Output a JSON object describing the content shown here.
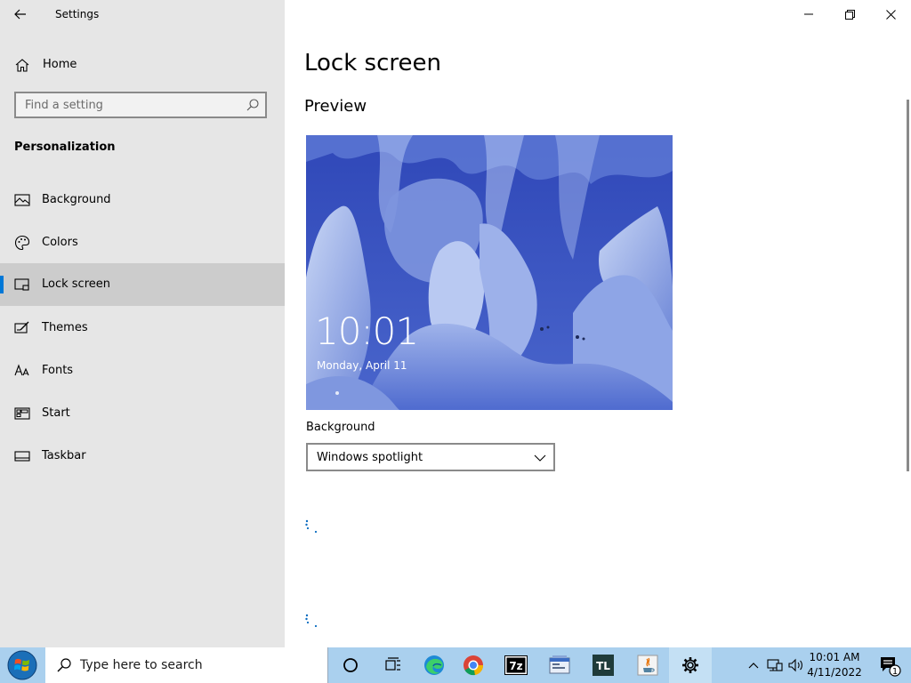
{
  "window": {
    "title": "Settings"
  },
  "sidebar": {
    "home_label": "Home",
    "search_placeholder": "Find a setting",
    "section_heading": "Personalization",
    "items": [
      {
        "label": "Background",
        "icon": "image-icon"
      },
      {
        "label": "Colors",
        "icon": "palette-icon"
      },
      {
        "label": "Lock screen",
        "icon": "lock-screen-icon",
        "selected": true
      },
      {
        "label": "Themes",
        "icon": "themes-icon"
      },
      {
        "label": "Fonts",
        "icon": "fonts-icon"
      },
      {
        "label": "Start",
        "icon": "start-icon"
      },
      {
        "label": "Taskbar",
        "icon": "taskbar-icon"
      }
    ]
  },
  "main": {
    "page_title": "Lock screen",
    "preview_heading": "Preview",
    "preview": {
      "time": "10:01",
      "date": "Monday, April 11"
    },
    "background_label": "Background",
    "background_value": "Windows spotlight"
  },
  "taskbar": {
    "search_placeholder": "Type here to search",
    "apps": [
      "cortana-icon",
      "task-view-icon",
      "edge-icon",
      "chrome-icon",
      "7zip-icon",
      "app-window-icon",
      "tl-app-icon",
      "java-icon",
      "settings-icon"
    ],
    "sevenzip_text": "7z",
    "tl_text": "TL",
    "clock_time": "10:01 AM",
    "clock_date": "4/11/2022",
    "notification_count": "1"
  },
  "colors": {
    "accent": "#0078d7",
    "sidebar_bg": "#e6e6e6",
    "selected_bg": "#cccccc",
    "taskbar_bg": "#aad0ee"
  }
}
